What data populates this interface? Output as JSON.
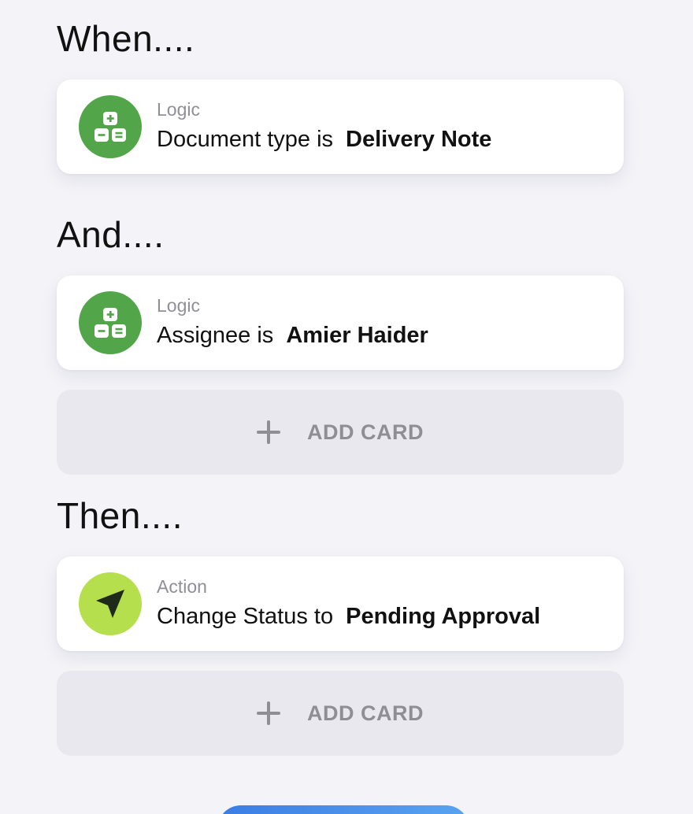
{
  "sections": {
    "when": {
      "heading": "When...."
    },
    "and": {
      "heading": "And...."
    },
    "then": {
      "heading": "Then...."
    }
  },
  "cards": [
    {
      "kind": "Logic",
      "condition": "Document type is",
      "value": "Delivery Note",
      "icon": "calculator-icon",
      "icon_color": "#52a548"
    },
    {
      "kind": "Logic",
      "condition": "Assignee is",
      "value": "Amier Haider",
      "icon": "calculator-icon",
      "icon_color": "#52a548"
    },
    {
      "kind": "Action",
      "condition": "Change Status to",
      "value": "Pending Approval",
      "icon": "navigation-arrow-icon",
      "icon_color": "#b5df4c"
    }
  ],
  "add_card": {
    "label": "ADD CARD",
    "icon": "plus-icon"
  },
  "colors": {
    "background": "#f3f3f8",
    "card_bg": "#ffffff",
    "add_card_bg": "#e8e8ee",
    "muted_text": "#8e8e94",
    "primary_button": "#3b7de4"
  }
}
